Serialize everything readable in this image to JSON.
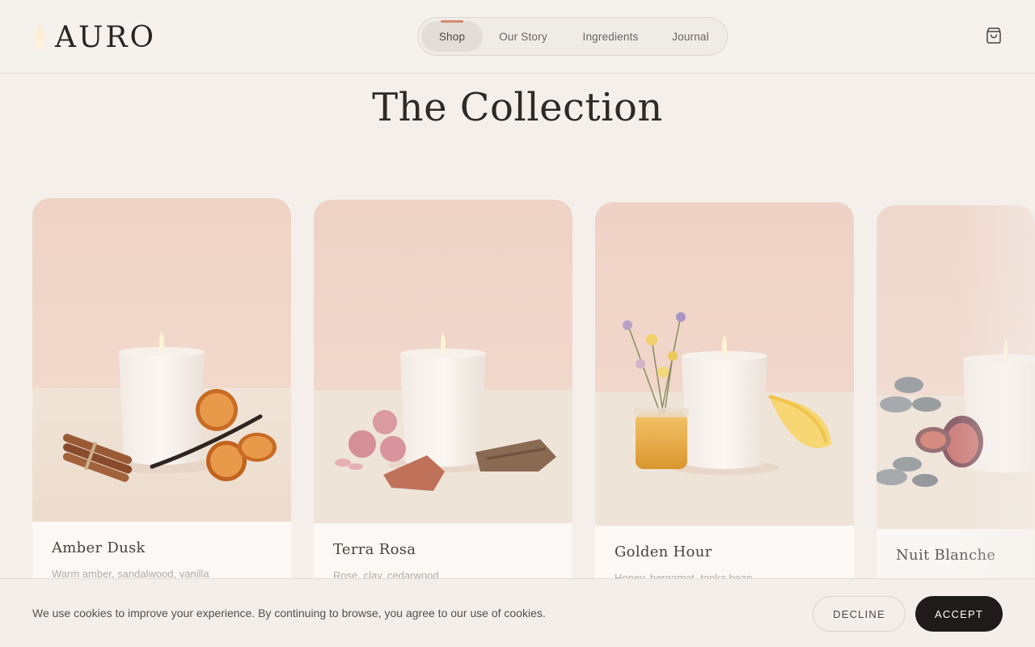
{
  "brand": {
    "name": "AURO"
  },
  "nav": {
    "items": [
      {
        "label": "Shop",
        "active": true
      },
      {
        "label": "Our Story",
        "active": false
      },
      {
        "label": "Ingredients",
        "active": false
      },
      {
        "label": "Journal",
        "active": false
      }
    ]
  },
  "cart": {
    "icon": "shopping-bag-icon"
  },
  "page": {
    "title": "The Collection"
  },
  "products": [
    {
      "name": "Amber Dusk",
      "notes": "Warm amber, sandalwood, vanilla"
    },
    {
      "name": "Terra Rosa",
      "notes": "Rose, clay, cedarwood"
    },
    {
      "name": "Golden Hour",
      "notes": "Honey, bergamot, tonka bean"
    },
    {
      "name": "Nuit Blanche",
      "notes": ""
    }
  ],
  "cookie": {
    "message": "We use cookies to improve your experience. By continuing to browse, you agree to our use of cookies.",
    "decline_label": "DECLINE",
    "accept_label": "ACCEPT"
  },
  "colors": {
    "background": "#f4efeb",
    "accent": "#d28b6e",
    "accept_button": "#1e1b1a"
  }
}
